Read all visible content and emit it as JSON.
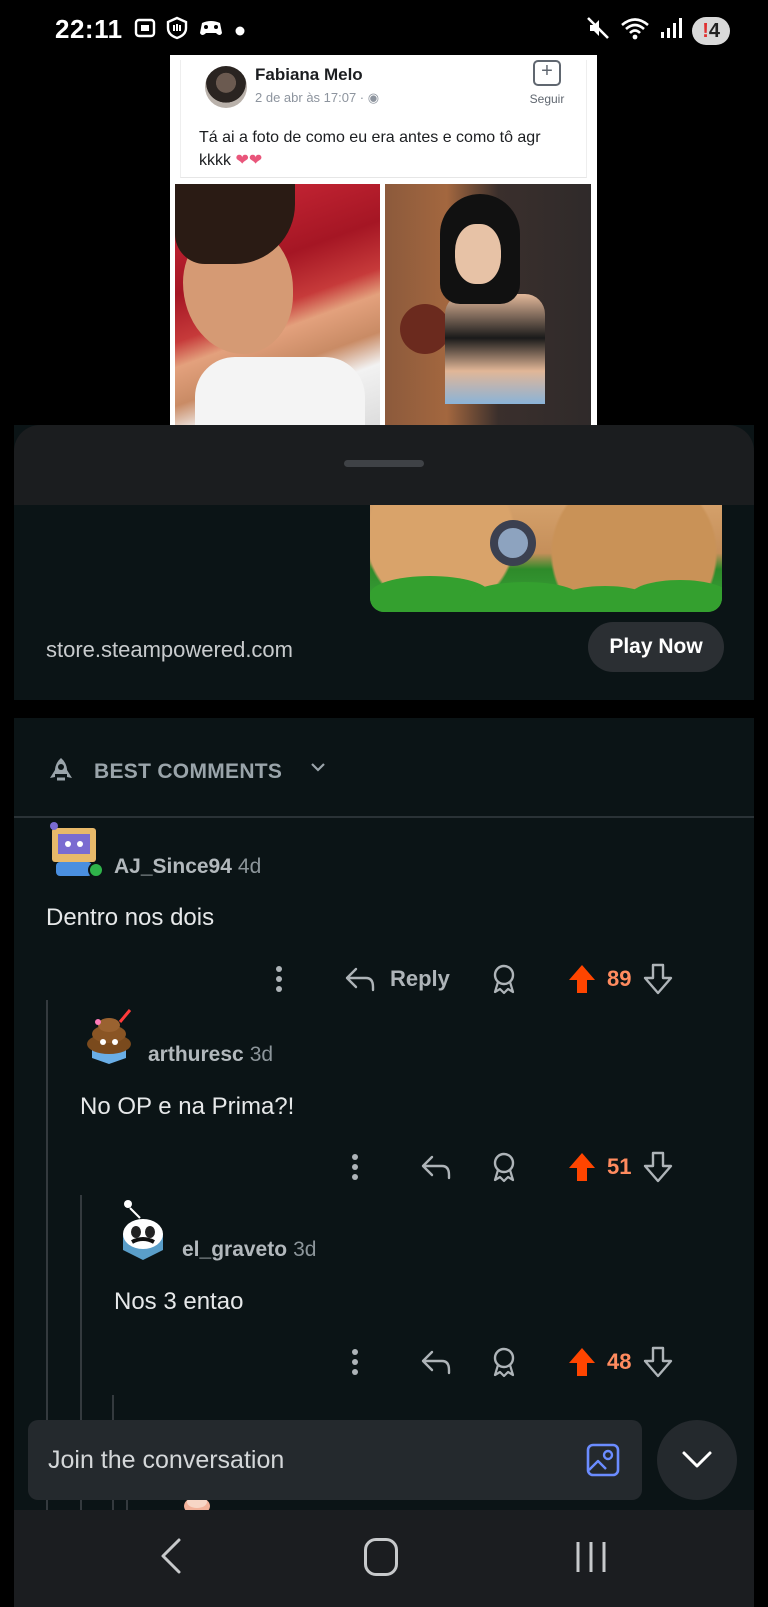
{
  "status_bar": {
    "time": "22:11",
    "left_icons": [
      "screenshot-icon",
      "hand-shield-icon",
      "game-controller-icon",
      "dot-icon"
    ],
    "right_icons": [
      "mute-icon",
      "wifi-icon",
      "signal-icon"
    ],
    "notification_count": "4"
  },
  "post_image": {
    "author": "Fabiana Melo",
    "date": "2 de abr às 17:07 · ",
    "follow_label": "Seguir",
    "text": "Tá ai a foto de como eu era antes e como tô agr kkkk ",
    "hearts": "❤❤"
  },
  "ad": {
    "domain": "store.steampowered.com",
    "cta": "Play Now"
  },
  "sort": {
    "label": "BEST COMMENTS"
  },
  "comments": [
    {
      "user": "AJ_Since94",
      "time": "4d",
      "body": "Dentro nos dois",
      "reply_label": "Reply",
      "score": "89"
    },
    {
      "user": "arthuresc",
      "time": "3d",
      "body": "No OP e na Prima?!",
      "score": "51"
    },
    {
      "user": "el_graveto",
      "time": "3d",
      "body": "Nos 3 entao",
      "score": "48"
    }
  ],
  "composer": {
    "placeholder": "Join the conversation"
  },
  "colors": {
    "upvote": "#ff4500",
    "score": "#ff8b5f",
    "background": "#0b1416",
    "accent_blue": "#6b8cff"
  }
}
